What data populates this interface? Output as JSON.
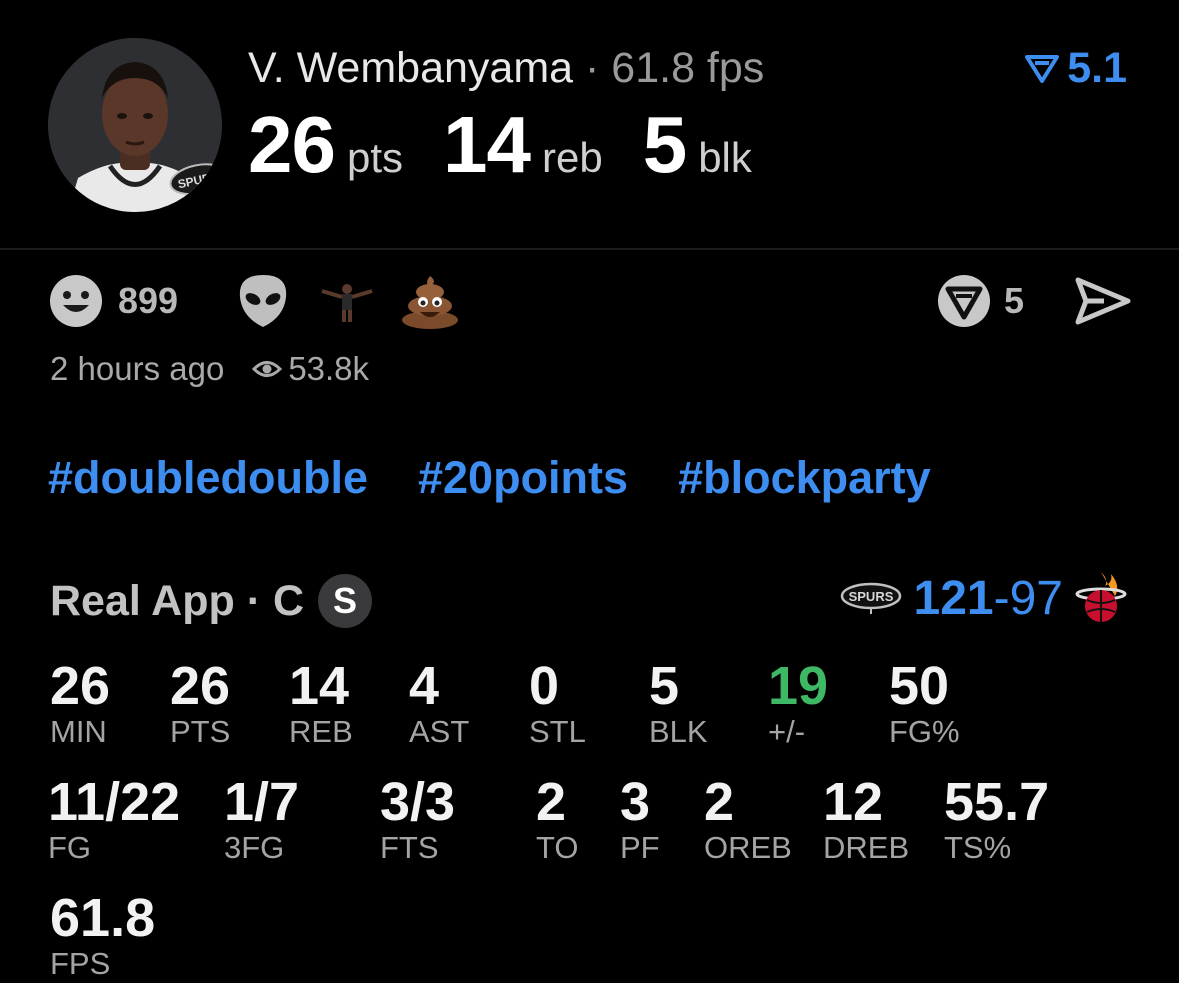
{
  "header": {
    "player_name": "V. Wembanyama",
    "separator": "·",
    "fps": "61.8 fps",
    "rating": "5.1",
    "stats": [
      {
        "value": "26",
        "unit": "pts"
      },
      {
        "value": "14",
        "unit": "reb"
      },
      {
        "value": "5",
        "unit": "blk"
      }
    ]
  },
  "reactions": {
    "count": "899",
    "icons": [
      "smiley-icon",
      "alien-icon",
      "player-emoji-icon",
      "poop-icon"
    ],
    "real_count": "5",
    "time_ago": "2 hours ago",
    "views": "53.8k"
  },
  "hashtags": [
    "#doubledouble",
    "#20points",
    "#blockparty"
  ],
  "game": {
    "app_label": "Real App · C",
    "badge": "S",
    "home_score": "121",
    "dash": "-",
    "away_score": "97"
  },
  "box": {
    "row1": [
      {
        "value": "26",
        "label": "MIN"
      },
      {
        "value": "26",
        "label": "PTS"
      },
      {
        "value": "14",
        "label": "REB"
      },
      {
        "value": "4",
        "label": "AST"
      },
      {
        "value": "0",
        "label": "STL"
      },
      {
        "value": "5",
        "label": "BLK"
      },
      {
        "value": "19",
        "label": "+/-"
      },
      {
        "value": "50",
        "label": "FG%"
      }
    ],
    "row2": [
      {
        "value": "11/22",
        "label": "FG"
      },
      {
        "value": "1/7",
        "label": "3FG"
      },
      {
        "value": "3/3",
        "label": "FTS"
      },
      {
        "value": "2",
        "label": "TO"
      },
      {
        "value": "3",
        "label": "PF"
      },
      {
        "value": "2",
        "label": "OREB"
      },
      {
        "value": "12",
        "label": "DREB"
      },
      {
        "value": "55.7",
        "label": "TS%"
      }
    ],
    "row3": [
      {
        "value": "61.8",
        "label": "FPS"
      }
    ]
  },
  "colors": {
    "accent": "#3d8ef0",
    "positive": "#3fb865",
    "background": "#000000"
  }
}
